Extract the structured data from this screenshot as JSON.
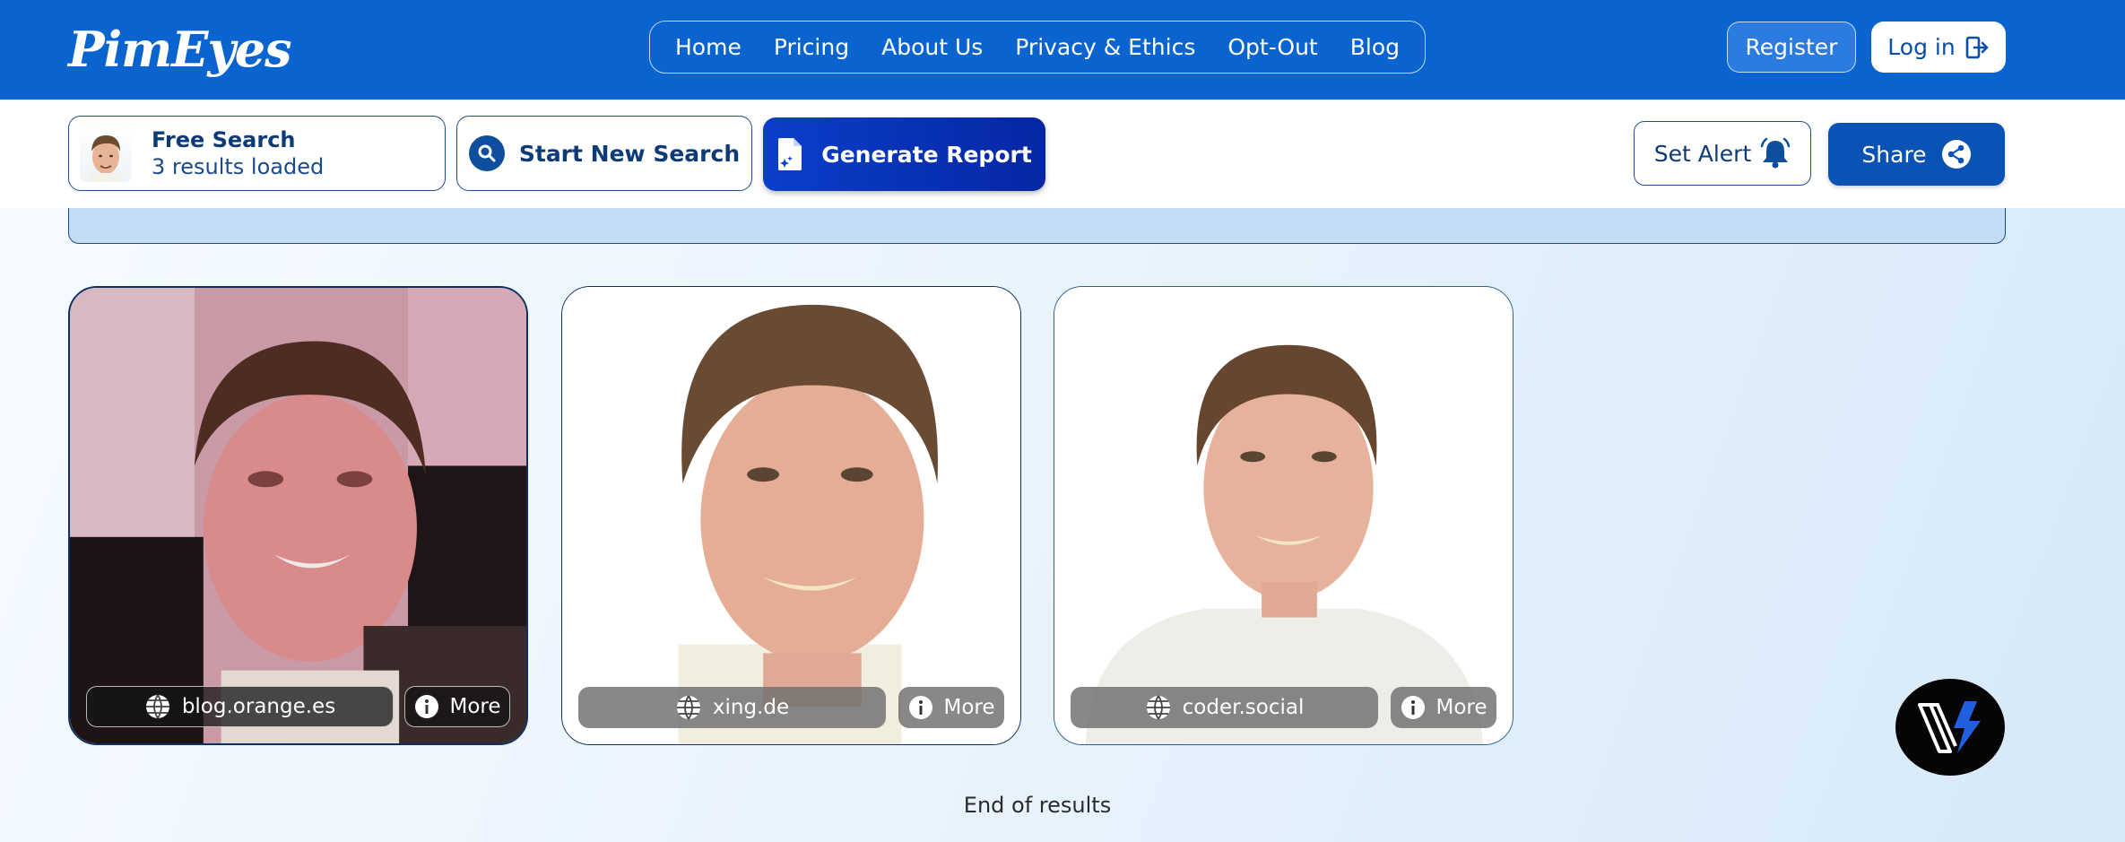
{
  "app": {
    "logo_text": "PimEyes"
  },
  "nav": {
    "items": [
      {
        "label": "Home"
      },
      {
        "label": "Pricing"
      },
      {
        "label": "About Us"
      },
      {
        "label": "Privacy & Ethics"
      },
      {
        "label": "Opt-Out"
      },
      {
        "label": "Blog"
      }
    ],
    "register_label": "Register",
    "login_label": "Log in"
  },
  "toolbar": {
    "search_title": "Free Search",
    "search_subtitle": "3 results loaded",
    "new_search_label": "Start New Search",
    "report_label": "Generate Report",
    "alert_label": "Set Alert",
    "share_label": "Share"
  },
  "results": [
    {
      "site": "blog.orange.es",
      "more_label": "More"
    },
    {
      "site": "xing.de",
      "more_label": "More"
    },
    {
      "site": "coder.social",
      "more_label": "More"
    }
  ],
  "footer": {
    "end_text": "End of results"
  },
  "colors": {
    "brand_blue": "#0a64d0",
    "report_blue": "#0a3fc9",
    "share_blue": "#0a52b4",
    "border_navy": "#1c4b8c"
  },
  "icons": {
    "login": "login-arrow-icon",
    "search": "search-icon",
    "report": "document-sparkle-icon",
    "alert": "bell-icon",
    "share": "share-icon",
    "site": "globe-icon",
    "more": "info-icon",
    "fab": "lightning-logo-icon"
  }
}
